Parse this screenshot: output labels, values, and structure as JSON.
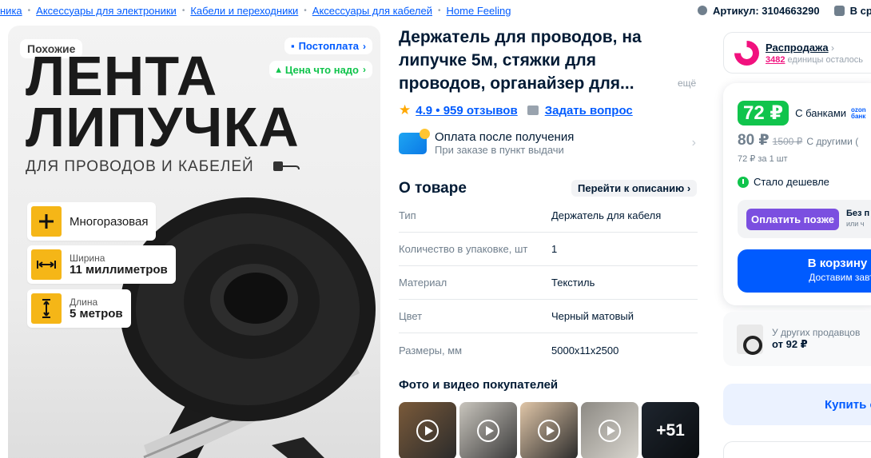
{
  "breadcrumbs": [
    "ника",
    "Аксессуары для электроники",
    "Кабели и переходники",
    "Аксессуары для кабелей",
    "Home Feeling"
  ],
  "article": {
    "label": "Артикул: 3104663290",
    "extra": "В ср"
  },
  "gallery": {
    "similar": "Похожие",
    "postpay": "Постоплата",
    "price_good": "Цена что надо",
    "title_line1": "ЛЕНТА",
    "title_line2": "ЛИПУЧКА",
    "subtitle": "ДЛЯ ПРОВОДОВ И КАБЕЛЕЙ",
    "features": [
      {
        "label": "",
        "value": "Многоразовая"
      },
      {
        "label": "Ширина",
        "value": "11 миллиметров"
      },
      {
        "label": "Длина",
        "value": "5 метров"
      }
    ]
  },
  "product": {
    "title": "Держатель для проводов, на липучке 5м, стяжки для проводов, органайзер для...",
    "more": "ещё",
    "rating": "4.9 • 959 отзывов",
    "ask": "Задать вопрос",
    "pay_after": {
      "title": "Оплата после получения",
      "subtitle": "При заказе в пункт выдачи"
    },
    "about_title": "О товаре",
    "goto_desc": "Перейти к описанию",
    "specs": [
      {
        "key": "Тип",
        "value": "Держатель для кабеля"
      },
      {
        "key": "Количество в упаковке, шт",
        "value": "1"
      },
      {
        "key": "Материал",
        "value": "Текстиль"
      },
      {
        "key": "Цвет",
        "value": "Черный матовый"
      },
      {
        "key": "Размеры, мм",
        "value": "5000x11x2500"
      }
    ],
    "photos_title": "Фото и видео покупателей",
    "photos_more": "+51"
  },
  "sidebar": {
    "sale_title": "Распродажа",
    "sale_count": "3482",
    "sale_rest": " единицы осталось",
    "price_bank": "72 ₽",
    "bank_label": "С банками",
    "bank_logo": "ozon банк",
    "price_other": "80 ₽",
    "price_old": "1500 ₽",
    "other_label": "С другими (",
    "per_unit": "72 ₽ за 1 шт",
    "cheaper": "Стало дешевле",
    "pay_later": "Оплатить позже",
    "pay_later_note1": "Без п",
    "pay_later_note2": "или ч",
    "cart_title": "В корзину",
    "cart_sub": "Доставим завт",
    "others_title": "У других продавцов",
    "others_price": "от 92 ₽",
    "buy_now": "Купить с"
  },
  "colors": {
    "accent": "#005bff",
    "green": "#10c44c",
    "pink": "#f1117e",
    "purple": "#7b4fe0",
    "feature_yellow": "#f5b617"
  }
}
